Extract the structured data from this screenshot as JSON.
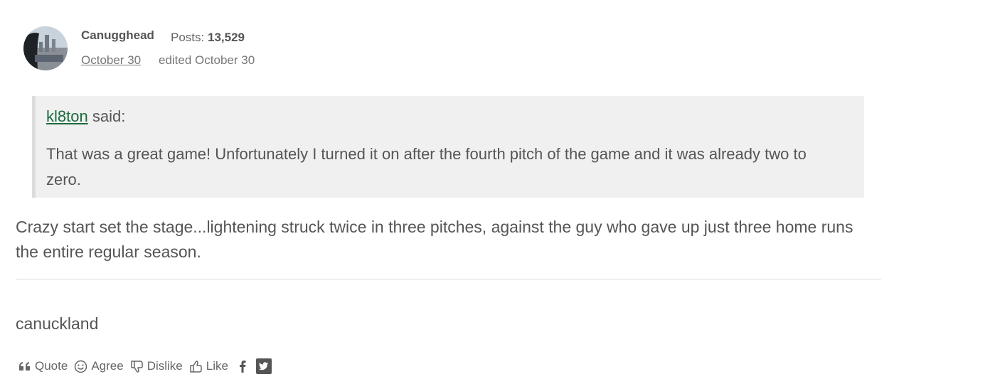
{
  "post": {
    "author": "Canugghead",
    "posts_label": "Posts:",
    "posts_count": "13,529",
    "date": "October 30",
    "edited": "edited October 30"
  },
  "quote": {
    "user": "kl8ton",
    "said": " said:",
    "text": "That was a great game!  Unfortunately I turned it on after the fourth pitch of the game and it was already two to zero."
  },
  "body": "Crazy start set the stage...lightening struck twice in three pitches, against the guy who gave up just three home runs the entire regular season.",
  "signature": "canuckland",
  "actions": {
    "quote": "Quote",
    "agree": "Agree",
    "dislike": "Dislike",
    "like": "Like"
  },
  "icons": [
    "quote-icon",
    "smile-icon",
    "thumbs-down-icon",
    "thumbs-up-icon",
    "facebook-icon",
    "twitter-icon"
  ]
}
